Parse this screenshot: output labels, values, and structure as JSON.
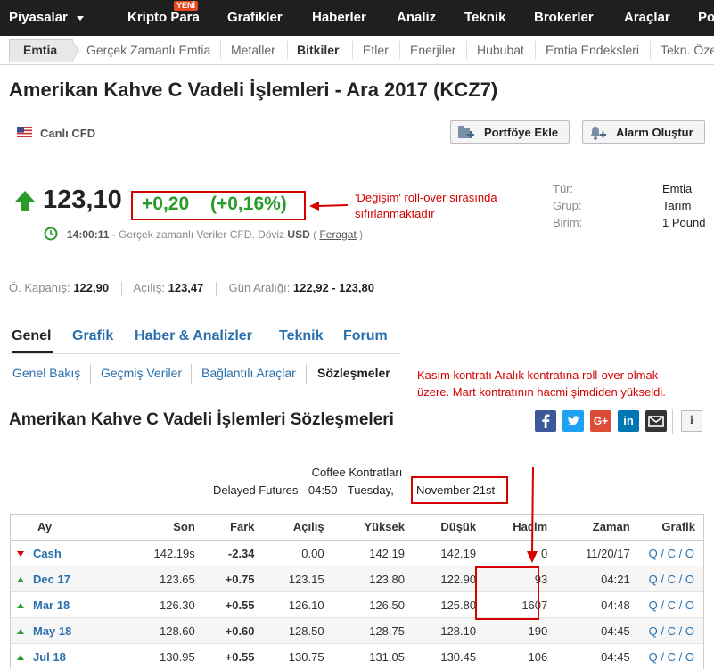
{
  "nav": {
    "brand": "Piyasalar",
    "items": [
      "Kripto Para",
      "Grafikler",
      "Haberler",
      "Analiz",
      "Teknik",
      "Brokerler",
      "Araçlar",
      "Po"
    ],
    "badge": "YENİ"
  },
  "subnav": {
    "items": [
      "Emtia",
      "Gerçek Zamanlı Emtia",
      "Metaller",
      "Bitkiler",
      "Etler",
      "Enerjiler",
      "Hububat",
      "Emtia Endeksleri",
      "Tekn. Öze"
    ]
  },
  "page": {
    "title": "Amerikan Kahve C Vadeli İşlemleri - Ara 2017 (KCZ7)",
    "live_label": "Canlı CFD",
    "portfolio_button": "Portföye Ekle",
    "alarm_button": "Alarm Oluştur"
  },
  "quote": {
    "price": "123,10",
    "change": "+0,20",
    "change_pct": "(+0,16%)",
    "time": "14:00:11",
    "note_prefix": " - Gerçek zamanlı Veriler CFD. Döviz ",
    "currency": "USD",
    "paren_open": " ( ",
    "disclaimer_link": "Feragat",
    "paren_close": " )",
    "annotation_line1": "'Değişim' roll-over sırasında",
    "annotation_line2": "sıfırlanmaktadır"
  },
  "info": {
    "labels": [
      "Tür:",
      "Grup:",
      "Birim:"
    ],
    "values": [
      "Emtia",
      "Tarım",
      "1 Pound"
    ]
  },
  "stats": {
    "prev_close_label": "Ö. Kapanış:",
    "prev_close": "122,90",
    "open_label": "Açılış:",
    "open": "123,47",
    "range_label": "Gün Aralığı:",
    "range": "122,92 - 123,80"
  },
  "tabs": [
    "Genel",
    "Grafik",
    "Haber & Analizler",
    "Teknik",
    "Forum"
  ],
  "subtabs": [
    "Genel Bakış",
    "Geçmiş Veriler",
    "Bağlantılı Araçlar",
    "Sözleşmeler"
  ],
  "annotation2": {
    "line1": "Kasım kontratı Aralık kontratına roll-over olmak",
    "line2": "üzere. Mart kontratının hacmi şimdiden yükseldi."
  },
  "section": {
    "title": "Amerikan Kahve C Vadeli İşlemleri Sözleşmeleri",
    "share_icons": [
      "facebook-icon",
      "twitter-icon",
      "google-plus-icon",
      "linkedin-icon",
      "email-icon",
      "info-icon"
    ],
    "table_title": "Coffee Kontratları",
    "table_subtitle": "Delayed Futures - 04:50 - Tuesday,",
    "table_date": "November 21st"
  },
  "table": {
    "headers": [
      "Ay",
      "Son",
      "Fark",
      "Açılış",
      "Yüksek",
      "Düşük",
      "Hacim",
      "Zaman",
      "Grafik"
    ],
    "rows": [
      {
        "month": "Cash",
        "last": "142.19s",
        "change": "-2.34",
        "open": "0.00",
        "high": "142.19",
        "low": "142.19",
        "volume": "0",
        "time": "11/20/17",
        "dir": "down"
      },
      {
        "month": "Dec 17",
        "last": "123.65",
        "change": "+0.75",
        "open": "123.15",
        "high": "123.80",
        "low": "122.90",
        "volume": "93",
        "time": "04:21",
        "dir": "up"
      },
      {
        "month": "Mar 18",
        "last": "126.30",
        "change": "+0.55",
        "open": "126.10",
        "high": "126.50",
        "low": "125.80",
        "volume": "1607",
        "time": "04:48",
        "dir": "up"
      },
      {
        "month": "May 18",
        "last": "128.60",
        "change": "+0.60",
        "open": "128.50",
        "high": "128.75",
        "low": "128.10",
        "volume": "190",
        "time": "04:45",
        "dir": "up"
      },
      {
        "month": "Jul 18",
        "last": "130.95",
        "change": "+0.55",
        "open": "130.75",
        "high": "131.05",
        "low": "130.45",
        "volume": "106",
        "time": "04:45",
        "dir": "up"
      }
    ],
    "chart_links": [
      "Q",
      "C",
      "O"
    ],
    "chart_sep": " / "
  },
  "colors": {
    "accent": "#2a6fad",
    "positive": "#2a9c2a",
    "negative": "#d50000",
    "nav_bg": "#1f1f1f"
  }
}
